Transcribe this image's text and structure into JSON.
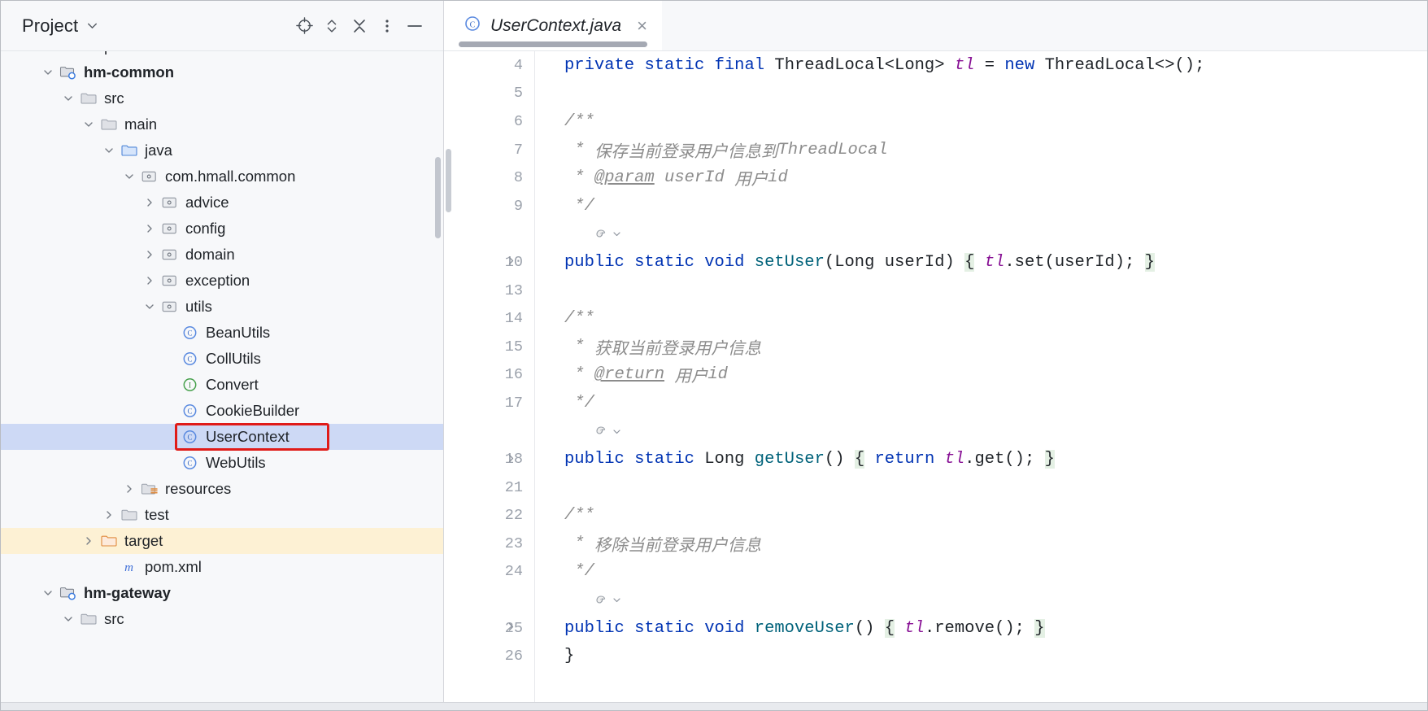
{
  "sidebar": {
    "title": "Project",
    "header_buttons": [
      {
        "name": "locate-target-icon",
        "glyph": "target"
      },
      {
        "name": "expand-collapse-icon",
        "glyph": "updown"
      },
      {
        "name": "collapse-all-icon",
        "glyph": "collapse"
      },
      {
        "name": "more-options-icon",
        "glyph": "dots"
      },
      {
        "name": "hide-panel-icon",
        "glyph": "minus"
      }
    ],
    "tree": [
      {
        "label": "pom.xml",
        "icon": "maven-icon",
        "indent": 2,
        "arrow": "none",
        "state": "clipped",
        "bold": false
      },
      {
        "label": "hm-common",
        "icon": "module-icon",
        "indent": 1,
        "arrow": "down",
        "state": "normal",
        "bold": true
      },
      {
        "label": "src",
        "icon": "folder-icon",
        "indent": 2,
        "arrow": "down",
        "state": "normal",
        "bold": false
      },
      {
        "label": "main",
        "icon": "folder-icon",
        "indent": 3,
        "arrow": "down",
        "state": "normal",
        "bold": false
      },
      {
        "label": "java",
        "icon": "source-folder-icon",
        "indent": 4,
        "arrow": "down",
        "state": "normal",
        "bold": false
      },
      {
        "label": "com.hmall.common",
        "icon": "package-icon",
        "indent": 5,
        "arrow": "down",
        "state": "normal",
        "bold": false
      },
      {
        "label": "advice",
        "icon": "package-icon",
        "indent": 6,
        "arrow": "right",
        "state": "normal",
        "bold": false
      },
      {
        "label": "config",
        "icon": "package-icon",
        "indent": 6,
        "arrow": "right",
        "state": "normal",
        "bold": false
      },
      {
        "label": "domain",
        "icon": "package-icon",
        "indent": 6,
        "arrow": "right",
        "state": "normal",
        "bold": false
      },
      {
        "label": "exception",
        "icon": "package-icon",
        "indent": 6,
        "arrow": "right",
        "state": "normal",
        "bold": false
      },
      {
        "label": "utils",
        "icon": "package-icon",
        "indent": 6,
        "arrow": "down",
        "state": "normal",
        "bold": false
      },
      {
        "label": "BeanUtils",
        "icon": "class-icon",
        "indent": 7,
        "arrow": "none",
        "state": "normal",
        "bold": false
      },
      {
        "label": "CollUtils",
        "icon": "class-icon",
        "indent": 7,
        "arrow": "none",
        "state": "normal",
        "bold": false
      },
      {
        "label": "Convert",
        "icon": "interface-icon",
        "indent": 7,
        "arrow": "none",
        "state": "normal",
        "bold": false
      },
      {
        "label": "CookieBuilder",
        "icon": "class-icon",
        "indent": 7,
        "arrow": "none",
        "state": "normal",
        "bold": false
      },
      {
        "label": "UserContext",
        "icon": "class-icon",
        "indent": 7,
        "arrow": "none",
        "state": "selected",
        "bold": false
      },
      {
        "label": "WebUtils",
        "icon": "class-icon",
        "indent": 7,
        "arrow": "none",
        "state": "normal",
        "bold": false
      },
      {
        "label": "resources",
        "icon": "resources-folder-icon",
        "indent": 5,
        "arrow": "right",
        "state": "normal",
        "bold": false
      },
      {
        "label": "test",
        "icon": "folder-icon",
        "indent": 4,
        "arrow": "right",
        "state": "normal",
        "bold": false
      },
      {
        "label": "target",
        "icon": "excluded-folder-icon",
        "indent": 3,
        "arrow": "right",
        "state": "amber",
        "bold": false
      },
      {
        "label": "pom.xml",
        "icon": "maven-icon",
        "indent": 4,
        "arrow": "none",
        "state": "normal",
        "bold": false
      },
      {
        "label": "hm-gateway",
        "icon": "module-icon",
        "indent": 1,
        "arrow": "down",
        "state": "normal",
        "bold": true
      },
      {
        "label": "src",
        "icon": "folder-icon",
        "indent": 2,
        "arrow": "down",
        "state": "normal",
        "bold": false
      }
    ]
  },
  "editor": {
    "tab": {
      "label": "UserContext.java",
      "icon": "java-class-icon",
      "close_label": "×"
    },
    "lines": [
      {
        "num": "4",
        "fold": "",
        "tokens": [
          {
            "t": "private",
            "c": "kw"
          },
          {
            "t": " ",
            "c": "pun"
          },
          {
            "t": "static",
            "c": "kw"
          },
          {
            "t": " ",
            "c": "pun"
          },
          {
            "t": "final",
            "c": "kw"
          },
          {
            "t": " ",
            "c": "pun"
          },
          {
            "t": "ThreadLocal<Long>",
            "c": "typ"
          },
          {
            "t": " ",
            "c": "pun"
          },
          {
            "t": "tl",
            "c": "fld"
          },
          {
            "t": " = ",
            "c": "pun"
          },
          {
            "t": "new",
            "c": "kw"
          },
          {
            "t": " ",
            "c": "pun"
          },
          {
            "t": "ThreadLocal<>();",
            "c": "typ"
          }
        ]
      },
      {
        "num": "5",
        "fold": "",
        "tokens": []
      },
      {
        "num": "6",
        "fold": "",
        "tokens": [
          {
            "t": "/**",
            "c": "cmt"
          }
        ]
      },
      {
        "num": "7",
        "fold": "",
        "tokens": [
          {
            "t": " * ",
            "c": "cmt"
          },
          {
            "t": "保存当前登录用户信息到",
            "c": "cmt"
          },
          {
            "t": "ThreadLocal",
            "c": "cmt"
          }
        ]
      },
      {
        "num": "8",
        "fold": "",
        "tokens": [
          {
            "t": " * ",
            "c": "cmt"
          },
          {
            "t": "@param",
            "c": "cmt-tag"
          },
          {
            "t": " userId ",
            "c": "cmt"
          },
          {
            "t": "用户",
            "c": "cmt"
          },
          {
            "t": "id",
            "c": "cmt"
          }
        ]
      },
      {
        "num": "9",
        "fold": "",
        "tokens": [
          {
            "t": " */",
            "c": "cmt"
          }
        ]
      },
      {
        "num": "",
        "fold": "",
        "marker": "bean-gutter-icon",
        "tokens": []
      },
      {
        "num": "10",
        "fold": "right",
        "tokens": [
          {
            "t": "public",
            "c": "kw"
          },
          {
            "t": " ",
            "c": "pun"
          },
          {
            "t": "static",
            "c": "kw"
          },
          {
            "t": " ",
            "c": "pun"
          },
          {
            "t": "void",
            "c": "kw"
          },
          {
            "t": " ",
            "c": "pun"
          },
          {
            "t": "setUser",
            "c": "mtd"
          },
          {
            "t": "(Long userId) ",
            "c": "pun"
          },
          {
            "t": "{",
            "c": "brace-hl"
          },
          {
            "t": " ",
            "c": "pun"
          },
          {
            "t": "tl",
            "c": "fld"
          },
          {
            "t": ".set(userId); ",
            "c": "pun"
          },
          {
            "t": "}",
            "c": "brace-hl"
          }
        ]
      },
      {
        "num": "13",
        "fold": "",
        "tokens": []
      },
      {
        "num": "14",
        "fold": "",
        "tokens": [
          {
            "t": "/**",
            "c": "cmt"
          }
        ]
      },
      {
        "num": "15",
        "fold": "",
        "tokens": [
          {
            "t": " * ",
            "c": "cmt"
          },
          {
            "t": "获取当前登录用户信息",
            "c": "cmt"
          }
        ]
      },
      {
        "num": "16",
        "fold": "",
        "tokens": [
          {
            "t": " * ",
            "c": "cmt"
          },
          {
            "t": "@return",
            "c": "cmt-tag"
          },
          {
            "t": " ",
            "c": "cmt"
          },
          {
            "t": "用户",
            "c": "cmt"
          },
          {
            "t": "id",
            "c": "cmt"
          }
        ]
      },
      {
        "num": "17",
        "fold": "",
        "tokens": [
          {
            "t": " */",
            "c": "cmt"
          }
        ]
      },
      {
        "num": "",
        "fold": "",
        "marker": "bean-gutter-icon",
        "tokens": []
      },
      {
        "num": "18",
        "fold": "right",
        "tokens": [
          {
            "t": "public",
            "c": "kw"
          },
          {
            "t": " ",
            "c": "pun"
          },
          {
            "t": "static",
            "c": "kw"
          },
          {
            "t": " ",
            "c": "pun"
          },
          {
            "t": "Long",
            "c": "typ"
          },
          {
            "t": " ",
            "c": "pun"
          },
          {
            "t": "getUser",
            "c": "mtd"
          },
          {
            "t": "() ",
            "c": "pun"
          },
          {
            "t": "{",
            "c": "brace-hl"
          },
          {
            "t": " ",
            "c": "pun"
          },
          {
            "t": "return",
            "c": "kw"
          },
          {
            "t": " ",
            "c": "pun"
          },
          {
            "t": "tl",
            "c": "fld"
          },
          {
            "t": ".get(); ",
            "c": "pun"
          },
          {
            "t": "}",
            "c": "brace-hl"
          }
        ]
      },
      {
        "num": "21",
        "fold": "",
        "tokens": []
      },
      {
        "num": "22",
        "fold": "",
        "tokens": [
          {
            "t": "/**",
            "c": "cmt"
          }
        ]
      },
      {
        "num": "23",
        "fold": "",
        "tokens": [
          {
            "t": " * ",
            "c": "cmt"
          },
          {
            "t": "移除当前登录用户信息",
            "c": "cmt"
          }
        ]
      },
      {
        "num": "24",
        "fold": "",
        "tokens": [
          {
            "t": " */",
            "c": "cmt"
          }
        ]
      },
      {
        "num": "",
        "fold": "",
        "marker": "bean-gutter-icon",
        "tokens": []
      },
      {
        "num": "25",
        "fold": "right",
        "tokens": [
          {
            "t": "public",
            "c": "kw"
          },
          {
            "t": " ",
            "c": "pun"
          },
          {
            "t": "static",
            "c": "kw"
          },
          {
            "t": " ",
            "c": "pun"
          },
          {
            "t": "void",
            "c": "kw"
          },
          {
            "t": " ",
            "c": "pun"
          },
          {
            "t": "removeUser",
            "c": "mtd"
          },
          {
            "t": "() ",
            "c": "pun"
          },
          {
            "t": "{",
            "c": "brace-hl"
          },
          {
            "t": " ",
            "c": "pun"
          },
          {
            "t": "tl",
            "c": "fld"
          },
          {
            "t": ".remove(); ",
            "c": "pun"
          },
          {
            "t": "}",
            "c": "brace-hl"
          }
        ]
      },
      {
        "num": "26",
        "fold": "",
        "tokens": [
          {
            "t": "}",
            "c": "pun"
          }
        ]
      }
    ]
  },
  "colors": {
    "selection_blue": "#cdd9f5",
    "annotation_red": "#e01b18",
    "amber_row": "#fdf1d4",
    "keyword_blue": "#0033b3",
    "field_purple": "#871094",
    "method_teal": "#00627a",
    "comment_gray": "#8c8c8c",
    "brace_highlight_green": "#e4f0e4"
  }
}
